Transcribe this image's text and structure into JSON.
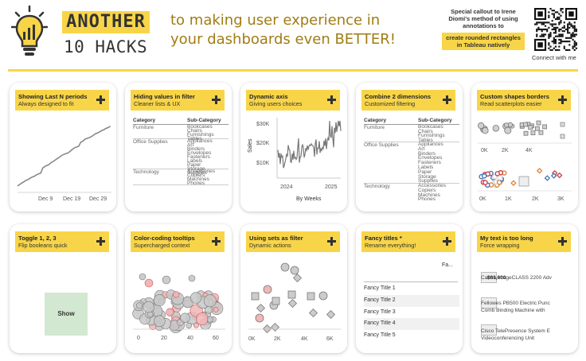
{
  "header": {
    "brand_line1": "ANOTHER",
    "brand_line2": "10 HACKS",
    "tagline_line1": "to making user experience in",
    "tagline_line2": "your dashboards even BETTER!",
    "callout_line1": "Special callout to Irene",
    "callout_line2": "Diomi's method of using",
    "callout_line3": "annotations to",
    "callout_highlight": "create rounded rectangles in Tableau natively",
    "qr_caption": "Connect with me"
  },
  "colors": {
    "accent": "#f8d548",
    "tagline": "#a17c12",
    "show_bg": "#d3e8d0"
  },
  "cards": [
    {
      "title": "Showing Last N periods",
      "subtitle": "Always designed to fit",
      "x_ticks": [
        "Dec 9",
        "Dec 19",
        "Dec 29"
      ]
    },
    {
      "title": "Hiding values in filter",
      "subtitle": "Cleaner lists & UX",
      "col1": "Category",
      "col2": "Sub-Category",
      "groups": [
        {
          "name": "Furniture",
          "subs": [
            "Bookcases",
            "Chairs",
            "Furnishings",
            "Tables"
          ]
        },
        {
          "name": "Office Supplies",
          "subs": [
            "Appliances",
            "Art",
            "Binders",
            "Envelopes",
            "Fasteners",
            "Labels",
            "Paper",
            "Storage",
            "Supplies"
          ]
        },
        {
          "name": "Technology",
          "subs": [
            "Accessories",
            "Copiers",
            "Machines",
            "Phones"
          ]
        }
      ]
    },
    {
      "title": "Dynamic axis",
      "subtitle": "Giving users choices",
      "y_ticks": [
        "$30K",
        "$20K",
        "$10K"
      ],
      "x_ticks": [
        "2024",
        "2025"
      ],
      "ylabel": "Sales",
      "xlabel": "By Weeks"
    },
    {
      "title": "Combine 2 dimensions",
      "subtitle": "Customized filtering",
      "col1": "Category",
      "col2": "Sub-Category",
      "groups": [
        {
          "name": "Furniture",
          "subs": [
            "Bookcases",
            "Chairs",
            "Furnishings",
            "Tables"
          ]
        },
        {
          "name": "Office Supplies",
          "subs": [
            "Appliances",
            "Art",
            "Binders",
            "Envelopes",
            "Fasteners",
            "Labels",
            "Paper",
            "Storage",
            "Supplies"
          ]
        },
        {
          "name": "Technology",
          "subs": [
            "Accessories",
            "Copiers",
            "Machines",
            "Phones"
          ]
        }
      ]
    },
    {
      "title": "Custom shapes borders",
      "subtitle": "Read scatterplots easier",
      "x_ticks_top": [
        "0K",
        "2K",
        "4K"
      ],
      "x_ticks_bottom": [
        "0K",
        "1K",
        "2K",
        "3K"
      ]
    },
    {
      "title": "Toggle 1, 2, 3",
      "subtitle": "Flip booleans quick",
      "button_label": "Show"
    },
    {
      "title": "Color-coding tooltips",
      "subtitle": "Supercharged context",
      "x_ticks": [
        "0",
        "20",
        "40",
        "60"
      ]
    },
    {
      "title": "Using sets as filter",
      "subtitle": "Dynamic actions",
      "x_ticks": [
        "0K",
        "2K",
        "4K",
        "6K"
      ]
    },
    {
      "title": "Fancy titles *",
      "subtitle": "Rename everything!",
      "fa_label": "Fa...",
      "items": [
        "Fancy Title 1",
        "Fancy Title 2",
        "Fancy Title 3",
        "Fancy Title 4",
        "Fancy Title 5"
      ]
    },
    {
      "title": "My text is too long",
      "subtitle": "Force wrapping",
      "rows": [
        "Canon imageCLASS 2200 Adv",
        "$61,600",
        "Fellowes PB500 Electric Punc",
        "Comb Binding Machine with",
        "Cisco TelePresence System E",
        "Videoconferencing Unit"
      ]
    }
  ]
}
